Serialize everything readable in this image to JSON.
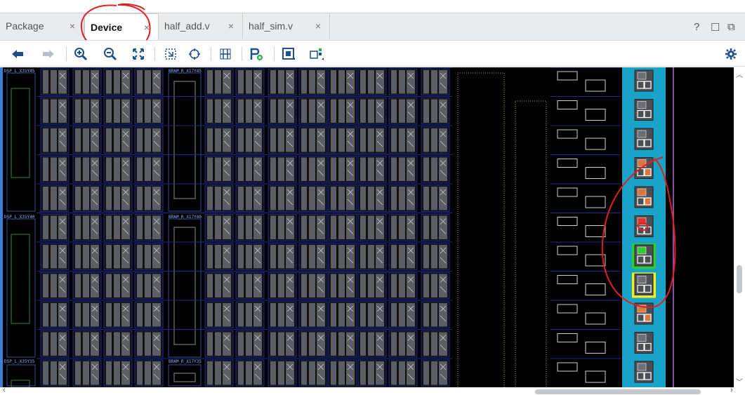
{
  "tabs": [
    {
      "label": "Package",
      "active": false
    },
    {
      "label": "Device",
      "active": true
    },
    {
      "label": "half_add.v",
      "active": false
    },
    {
      "label": "half_sim.v",
      "active": false
    }
  ],
  "tab_close_glyph": "×",
  "window_controls": {
    "help": "?",
    "maximize": "☐",
    "float": "⧉"
  },
  "toolbar": {
    "icons": [
      "back-arrow-icon",
      "forward-arrow-icon",
      "zoom-in-icon",
      "zoom-out-icon",
      "zoom-fit-icon",
      "zoom-area-icon",
      "crosshair-icon",
      "routing-resources-icon",
      "add-pblock-icon",
      "select-area-icon",
      "cell-select-icon",
      "gear-icon"
    ]
  },
  "device": {
    "site_labels": [
      "DSP_L_X35Y45",
      "BRAM_R_X17Y45",
      "DSP_L_X35Y40",
      "BRAM_R_X17Y40",
      "DSP_L_X35Y35",
      "BRAM_R_X17Y35"
    ],
    "colors": {
      "background": "#000000",
      "clb_fill": "#5a5f66",
      "clb_border": "#1e2b8a",
      "io_column": "#1aa3c9",
      "io_highlight_green": "#2ecc2e",
      "io_highlight_yellow": "#f0f020",
      "io_highlight_orange": "#d8783c",
      "io_highlight_red": "#e03030",
      "annotation": "#e02020"
    }
  }
}
